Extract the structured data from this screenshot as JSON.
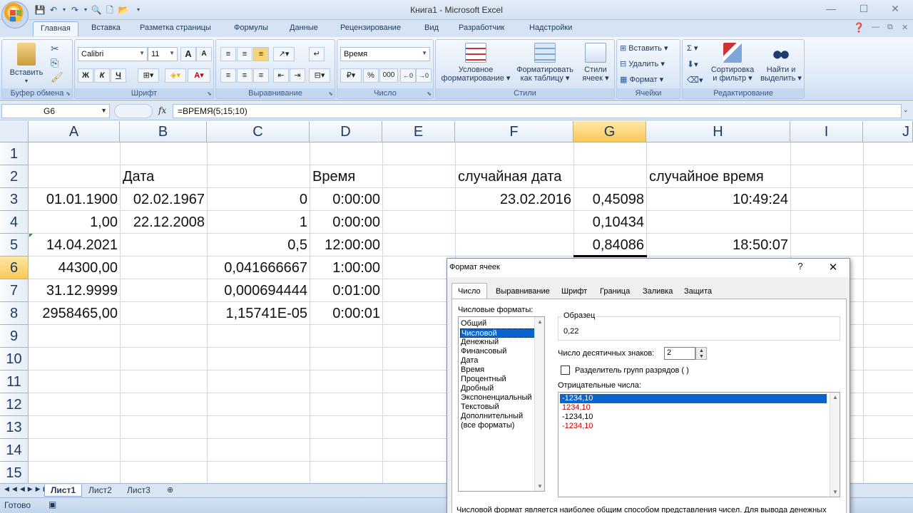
{
  "window": {
    "title": "Книга1 - Microsoft Excel",
    "minimize": "—",
    "maximize": "☐",
    "close": "✕"
  },
  "ribbon_tabs": [
    "Главная",
    "Вставка",
    "Разметка страницы",
    "Формулы",
    "Данные",
    "Рецензирование",
    "Вид",
    "Разработчик",
    "Надстройки"
  ],
  "ribbon": {
    "clipboard": {
      "paste": "Вставить",
      "label": "Буфер обмена"
    },
    "font": {
      "name": "Calibri",
      "size": "11",
      "bold": "Ж",
      "italic": "К",
      "underline": "Ч",
      "label": "Шрифт"
    },
    "alignment": {
      "label": "Выравнивание"
    },
    "number": {
      "format": "Время",
      "percent": "%",
      "thousands": "000",
      "label": "Число"
    },
    "styles": {
      "conditional_1": "Условное",
      "conditional_2": "форматирование ▾",
      "table_1": "Форматировать",
      "table_2": "как таблицу ▾",
      "cell_styles_1": "Стили",
      "cell_styles_2": "ячеек ▾",
      "label": "Стили"
    },
    "cells": {
      "insert": "Вставить ▾",
      "delete": "Удалить ▾",
      "format": "Формат ▾",
      "label": "Ячейки"
    },
    "editing": {
      "sum": "Σ ▾",
      "sort_1": "Сортировка",
      "sort_2": "и фильтр ▾",
      "find_1": "Найти и",
      "find_2": "выделить ▾",
      "label": "Редактирование"
    }
  },
  "formula_bar": {
    "name_box": "G6",
    "fx": "fx",
    "formula": "=ВРЕМЯ(5;15;10)"
  },
  "columns": [
    "A",
    "B",
    "C",
    "D",
    "E",
    "F",
    "G",
    "H",
    "I",
    "J"
  ],
  "rows": [
    "1",
    "2",
    "3",
    "4",
    "5",
    "6",
    "7",
    "8",
    "9",
    "10",
    "11",
    "12",
    "13",
    "14",
    "15"
  ],
  "selected_cell": "G6",
  "cells": {
    "B2": "Дата",
    "D2": "Время",
    "F2": "случайная дата",
    "H2": "случайное время",
    "A3": "01.01.1900",
    "B3": "02.02.1967",
    "C3": "0",
    "D3": "0:00:00",
    "F3": "23.02.2016",
    "G3": "0,45098",
    "H3": "10:49:24",
    "A4": "1,00",
    "B4": "22.12.2008",
    "C4": "1",
    "D4": "0:00:00",
    "G4": "0,10434",
    "A5": "14.04.2021",
    "C5": "0,5",
    "D5": "12:00:00",
    "G5": "0,84086",
    "H5": "18:50:07",
    "A6": "44300,00",
    "C6": "0,041666667",
    "D6": "1:00:00",
    "A7": "31.12.9999",
    "C7": "0,000694444",
    "D7": "0:01:00",
    "A8": "2958465,00",
    "C8": "1,15741E-05",
    "D8": "0:00:01"
  },
  "sheet_tabs": [
    "Лист1",
    "Лист2",
    "Лист3"
  ],
  "status": {
    "ready": "Готово"
  },
  "dialog": {
    "title": "Формат ячеек",
    "help": "?",
    "close": "✕",
    "tabs": [
      "Число",
      "Выравнивание",
      "Шрифт",
      "Граница",
      "Заливка",
      "Защита"
    ],
    "categories_label": "Числовые форматы:",
    "categories": [
      "Общий",
      "Числовой",
      "Денежный",
      "Финансовый",
      "Дата",
      "Время",
      "Процентный",
      "Дробный",
      "Экспоненциальный",
      "Текстовый",
      "Дополнительный",
      "(все форматы)"
    ],
    "selected_category": "Числовой",
    "sample_label": "Образец",
    "sample_value": "0,22",
    "decimals_label": "Число десятичных знаков:",
    "decimals_value": "2",
    "separator_label": "Разделитель групп разрядов ( )",
    "negative_label": "Отрицательные числа:",
    "negative_formats": [
      "-1234,10",
      "1234,10",
      "-1234,10",
      "-1234,10"
    ],
    "description": "Числовой формат является наиболее общим способом представления чисел. Для вывода денежных"
  }
}
